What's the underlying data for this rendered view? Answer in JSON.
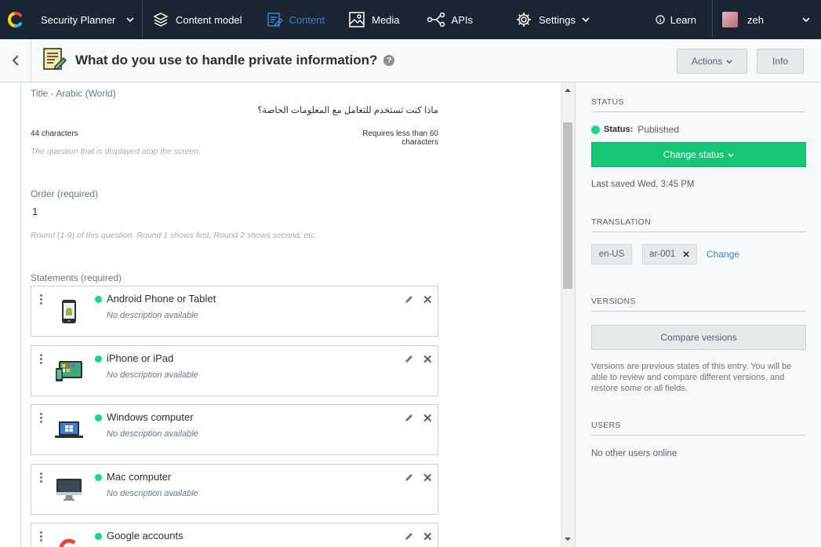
{
  "nav": {
    "space_name": "Security Planner",
    "items": [
      {
        "label": "Content model",
        "icon": "layers-icon"
      },
      {
        "label": "Content",
        "icon": "content-edit-icon",
        "active": true
      },
      {
        "label": "Media",
        "icon": "media-image-icon"
      },
      {
        "label": "APIs",
        "icon": "api-share-icon"
      },
      {
        "label": "Settings",
        "icon": "gear-icon"
      }
    ],
    "learn_label": "Learn",
    "user_name": "zeh"
  },
  "entry": {
    "title": "What do you use to handle private information?",
    "actions_label": "Actions",
    "info_label": "Info"
  },
  "fields": {
    "title_label": "Title - Arabic (World)",
    "title_value": "ماذا كنت تستخدم للتعامل مع المعلومات الخاصة؟",
    "title_count": "44 characters",
    "title_limit": "Requires less than 60 characters",
    "title_hint": "The question that is displayed atop the screen.",
    "order_label": "Order (required)",
    "order_value": "1",
    "order_hint": "Round (1-9) of this question. Round 1 shows first, Round 2 shows second, etc.",
    "statements_label": "Statements (required)"
  },
  "statements": [
    {
      "name": "Android Phone or Tablet",
      "desc": "No description available",
      "icon": "android-phone-icon"
    },
    {
      "name": "iPhone or iPad",
      "desc": "No description available",
      "icon": "ipad-iphone-icon"
    },
    {
      "name": "Windows computer",
      "desc": "No description available",
      "icon": "windows-laptop-icon"
    },
    {
      "name": "Mac computer",
      "desc": "No description available",
      "icon": "imac-icon"
    },
    {
      "name": "Google accounts",
      "desc": "",
      "icon": "google-icon"
    }
  ],
  "sidebar": {
    "status_heading": "STATUS",
    "status_label": "Status:",
    "status_value": "Published",
    "change_status": "Change status",
    "last_saved": "Last saved Wed, 3:45 PM",
    "translation_heading": "TRANSLATION",
    "locale_1": "en-US",
    "locale_2": "ar-001",
    "change_link": "Change",
    "versions_heading": "VERSIONS",
    "compare_button": "Compare versions",
    "versions_text": "Versions are previous states of this entry. You will be able to review and compare different versions, and restore some or all fields.",
    "users_heading": "USERS",
    "users_text": "No other users online"
  },
  "colors": {
    "nav_bg": "#192532",
    "accent_blue": "#3c80cf",
    "green": "#14d882",
    "button_green": "#15c676"
  }
}
